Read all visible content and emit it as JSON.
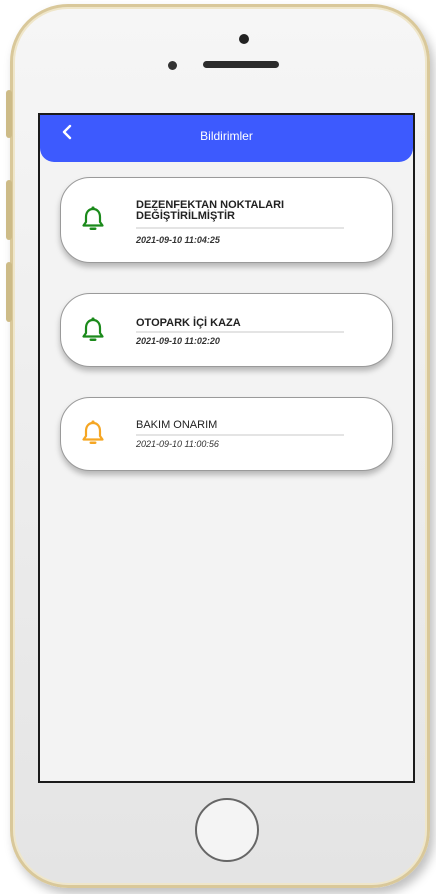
{
  "header": {
    "title": "Bildirimler",
    "back_icon": "chevron-left-icon",
    "color": "#3d5afe"
  },
  "notifications": [
    {
      "title": "DEZENFEKTAN NOKTALARI DEĞİŞTİRİLMİŞTİR",
      "date": "2021-09-10 11:04:25",
      "icon": "bell-icon",
      "color": "#1b8a1b",
      "read": false
    },
    {
      "title": "OTOPARK İÇİ KAZA",
      "date": "2021-09-10 11:02:20",
      "icon": "bell-icon",
      "color": "#1b8a1b",
      "read": false
    },
    {
      "title": "BAKIM ONARIM",
      "date": "2021-09-10 11:00:56",
      "icon": "bell-icon",
      "color": "#f5a623",
      "read": true
    }
  ]
}
